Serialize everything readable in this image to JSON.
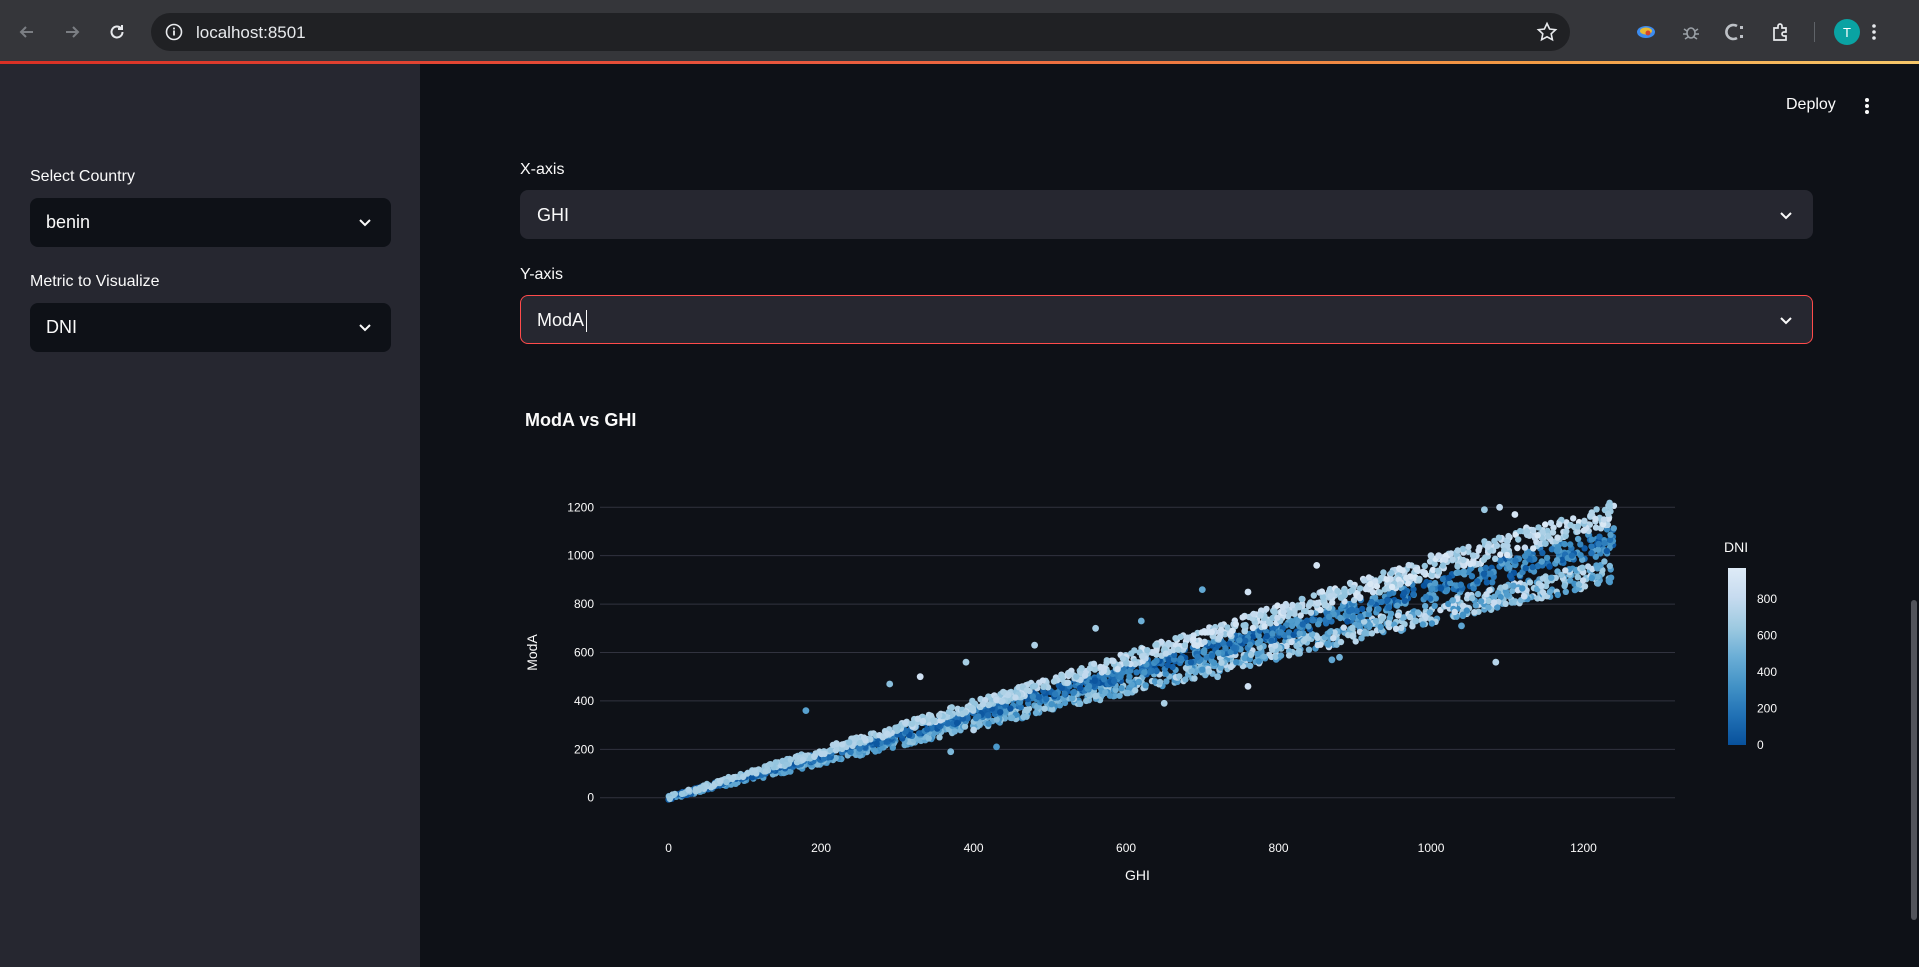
{
  "browser": {
    "url": "localhost:8501",
    "avatar_letter": "T"
  },
  "header": {
    "deploy_label": "Deploy"
  },
  "sidebar": {
    "country_label": "Select Country",
    "country_value": "benin",
    "metric_label": "Metric to Visualize",
    "metric_value": "DNI"
  },
  "main": {
    "x_label": "X-axis",
    "x_value": "GHI",
    "y_label": "Y-axis",
    "y_value": "ModA"
  },
  "colors": {
    "accent_focus": "#ff4b4b",
    "sidebar_bg": "#262730",
    "app_bg": "#0e1117",
    "colorscale": [
      "#08519c",
      "#2171b5",
      "#4292c6",
      "#6baed6",
      "#9ecae1",
      "#c6dbef",
      "#deebf7"
    ]
  },
  "chart_data": {
    "type": "scatter",
    "title": "ModA vs GHI",
    "xlabel": "GHI",
    "ylabel": "ModA",
    "xlim": [
      -90,
      1320
    ],
    "ylim": [
      -30,
      1230
    ],
    "xticks": [
      0,
      200,
      400,
      600,
      800,
      1000,
      1200
    ],
    "yticks": [
      0,
      200,
      400,
      600,
      800,
      1000,
      1200
    ],
    "grid": "horizontal",
    "colorbar": {
      "title": "DNI",
      "ticks": [
        0,
        200,
        400,
        600,
        800
      ],
      "range": [
        0,
        970
      ]
    },
    "bands": [
      {
        "name": "upper",
        "slope": 0.95,
        "dni_low": 600,
        "dni_high": 950
      },
      {
        "name": "middle",
        "slope": 0.86,
        "dni_low": 0,
        "dni_high": 450
      },
      {
        "name": "lower",
        "slope": 0.78,
        "dni_low": 300,
        "dni_high": 850
      }
    ],
    "x_range": [
      0,
      1240
    ],
    "outliers": [
      {
        "x": 1090,
        "y": 1200
      },
      {
        "x": 1070,
        "y": 1190
      },
      {
        "x": 980,
        "y": 730
      },
      {
        "x": 1040,
        "y": 710
      },
      {
        "x": 1085,
        "y": 560
      },
      {
        "x": 870,
        "y": 570
      },
      {
        "x": 880,
        "y": 580
      },
      {
        "x": 760,
        "y": 460
      },
      {
        "x": 720,
        "y": 500
      },
      {
        "x": 650,
        "y": 390
      },
      {
        "x": 560,
        "y": 420
      },
      {
        "x": 470,
        "y": 360
      },
      {
        "x": 450,
        "y": 330
      },
      {
        "x": 400,
        "y": 280
      },
      {
        "x": 430,
        "y": 210
      },
      {
        "x": 370,
        "y": 190
      },
      {
        "x": 180,
        "y": 360
      },
      {
        "x": 290,
        "y": 470
      },
      {
        "x": 330,
        "y": 500
      },
      {
        "x": 390,
        "y": 560
      },
      {
        "x": 480,
        "y": 630
      },
      {
        "x": 560,
        "y": 700
      },
      {
        "x": 700,
        "y": 860
      },
      {
        "x": 760,
        "y": 850
      },
      {
        "x": 1000,
        "y": 1000
      },
      {
        "x": 1110,
        "y": 1170
      },
      {
        "x": 1010,
        "y": 1000
      },
      {
        "x": 620,
        "y": 730
      },
      {
        "x": 850,
        "y": 960
      },
      {
        "x": 1150,
        "y": 1050
      }
    ]
  }
}
